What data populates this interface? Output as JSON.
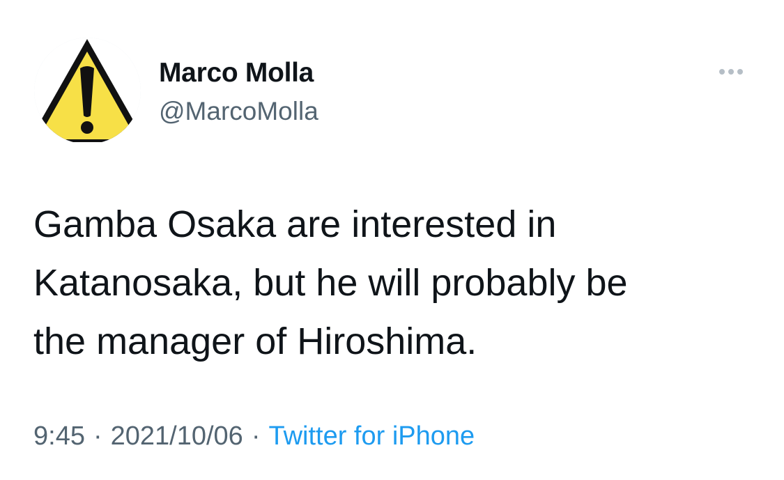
{
  "tweet": {
    "author": {
      "display_name": "Marco Molla",
      "handle": "@MarcoMolla",
      "avatar_icon": "warning-sign-icon"
    },
    "more_icon": "more-options-icon",
    "text_lines": [
      "Gamba Osaka are interested in",
      "Katanosaka, but he will probably be",
      "the manager of Hiroshima."
    ],
    "meta": {
      "time": "9:45",
      "separator": "·",
      "date": "2021/10/06",
      "source": "Twitter for iPhone"
    }
  },
  "colors": {
    "text_primary": "#0f1419",
    "text_secondary": "#536471",
    "link": "#1d9bf0",
    "warning_yellow": "#f7e047"
  }
}
